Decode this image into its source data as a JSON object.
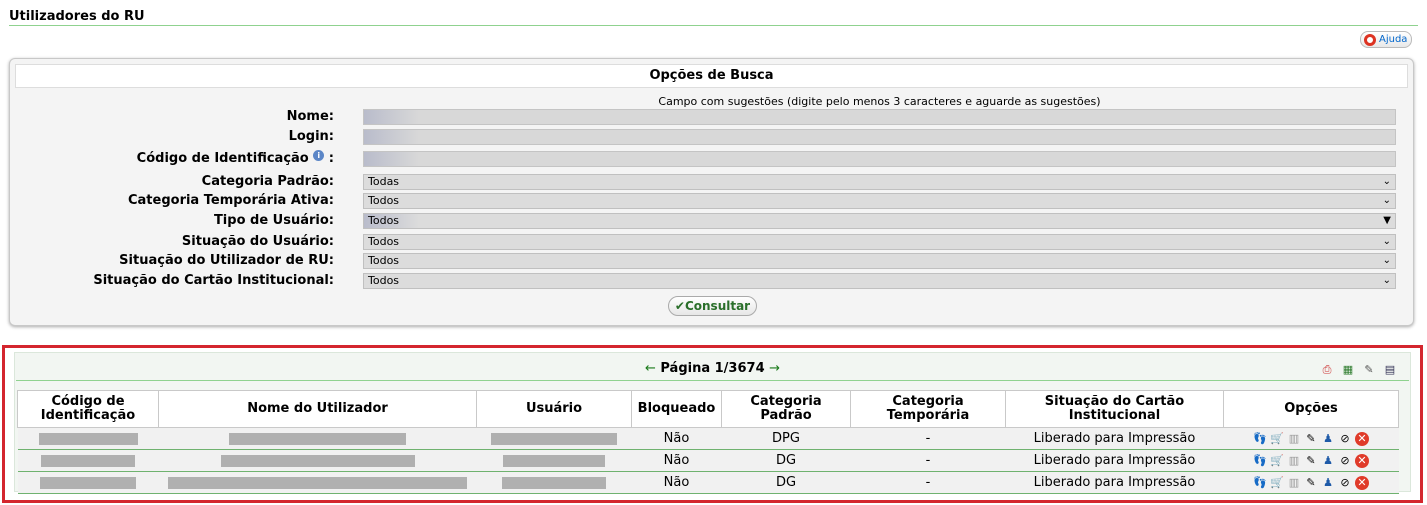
{
  "page": {
    "title": "Utilizadores do RU",
    "help_label": "Ajuda"
  },
  "search": {
    "header": "Opções de Busca",
    "hint": "Campo com sugestões (digite pelo menos 3 caracteres e aguarde as sugestões)",
    "labels": {
      "nome": "Nome:",
      "login": "Login:",
      "codigo": "Código de Identificação",
      "categoria_padrao": "Categoria Padrão:",
      "categoria_temporaria": "Categoria Temporária Ativa:",
      "tipo_usuario": "Tipo de Usuário:",
      "situacao_usuario": "Situação do Usuário:",
      "situacao_utilizador": "Situação do Utilizador de RU:",
      "situacao_cartao": "Situação do Cartão Institucional:"
    },
    "values": {
      "categoria_padrao": "Todas",
      "categoria_temporaria": "Todos",
      "tipo_usuario": "Todos",
      "situacao_usuario": "Todos",
      "situacao_utilizador": "Todos",
      "situacao_cartao": "Todos"
    },
    "consult_label": "Consultar"
  },
  "results": {
    "pager": "Página 1/3674",
    "columns": [
      "Código de Identificação",
      "Nome do Utilizador",
      "Usuário",
      "Bloqueado",
      "Categoria Padrão",
      "Categoria Temporária",
      "Situação do Cartão Institucional",
      "Opções"
    ],
    "rows": [
      {
        "bloqueado": "Não",
        "categoria_padrao": "DPG",
        "categoria_temporaria": "-",
        "situacao": "Liberado para Impressão"
      },
      {
        "bloqueado": "Não",
        "categoria_padrao": "DG",
        "categoria_temporaria": "-",
        "situacao": "Liberado para Impressão"
      },
      {
        "bloqueado": "Não",
        "categoria_padrao": "DG",
        "categoria_temporaria": "-",
        "situacao": "Liberado para Impressão"
      }
    ]
  }
}
